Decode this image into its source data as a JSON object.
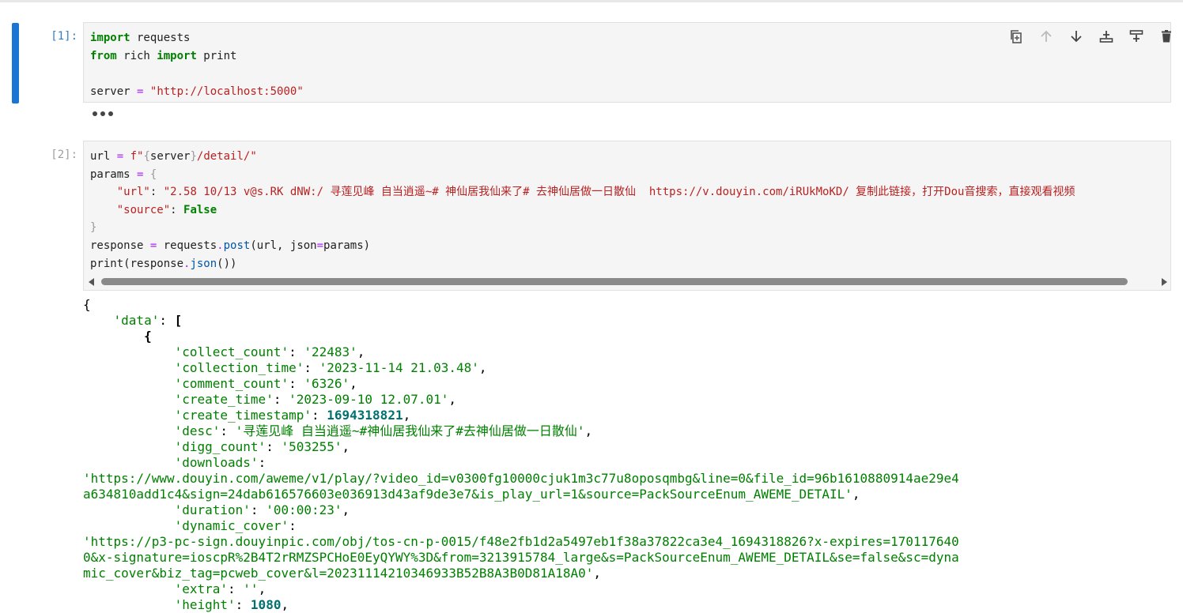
{
  "cells": [
    {
      "prompt": "[1]:",
      "code_lines": [
        [
          {
            "t": "import",
            "c": "kw"
          },
          {
            "t": " requests"
          }
        ],
        [
          {
            "t": "from",
            "c": "kw"
          },
          {
            "t": " rich "
          },
          {
            "t": "import",
            "c": "kw"
          },
          {
            "t": " print"
          }
        ],
        [
          {
            "t": ""
          }
        ],
        [
          {
            "t": "server "
          },
          {
            "t": "=",
            "c": "op"
          },
          {
            "t": " "
          },
          {
            "t": "\"http://localhost:5000\"",
            "c": "str"
          }
        ]
      ]
    },
    {
      "prompt": "[2]:",
      "code_lines": [
        [
          {
            "t": "url "
          },
          {
            "t": "=",
            "c": "op"
          },
          {
            "t": " "
          },
          {
            "t": "f\"",
            "c": "str"
          },
          {
            "t": "{",
            "c": "br"
          },
          {
            "t": "server"
          },
          {
            "t": "}",
            "c": "br"
          },
          {
            "t": "/detail/\"",
            "c": "str"
          }
        ],
        [
          {
            "t": "params "
          },
          {
            "t": "=",
            "c": "op"
          },
          {
            "t": " "
          },
          {
            "t": "{",
            "c": "br"
          }
        ],
        [
          {
            "t": "    "
          },
          {
            "t": "\"url\"",
            "c": "str"
          },
          {
            "t": ": "
          },
          {
            "t": "\"2.58 10/13 v@s.RK dNW:/ 寻莲见峰 自当逍遥~# 神仙居我仙来了# 去神仙居做一日散仙  https://v.douyin.com/iRUkMoKD/ 复制此链接，打开Dou音搜索，直接观看视频",
            "c": "str"
          }
        ],
        [
          {
            "t": "    "
          },
          {
            "t": "\"source\"",
            "c": "str"
          },
          {
            "t": ": "
          },
          {
            "t": "False",
            "c": "kw"
          }
        ],
        [
          {
            "t": "}",
            "c": "br"
          }
        ],
        [
          {
            "t": "response "
          },
          {
            "t": "=",
            "c": "op"
          },
          {
            "t": " requests"
          },
          {
            "t": ".",
            "c": "op"
          },
          {
            "t": "post",
            "c": "fn"
          },
          {
            "t": "(url, json"
          },
          {
            "t": "=",
            "c": "op"
          },
          {
            "t": "params)"
          }
        ],
        [
          {
            "t": "print(response"
          },
          {
            "t": ".",
            "c": "op"
          },
          {
            "t": "json",
            "c": "fn"
          },
          {
            "t": "())"
          }
        ]
      ]
    }
  ],
  "output_lines": [
    [
      {
        "t": "{"
      }
    ],
    [
      {
        "t": "    "
      },
      {
        "t": "'data'",
        "c": "ok"
      },
      {
        "t": ": "
      },
      {
        "t": "[",
        "c": "ob"
      }
    ],
    [
      {
        "t": "        "
      },
      {
        "t": "{",
        "c": "ob"
      }
    ],
    [
      {
        "t": "            "
      },
      {
        "t": "'collect_count'",
        "c": "ok"
      },
      {
        "t": ": "
      },
      {
        "t": "'22483'",
        "c": "ok"
      },
      {
        "t": ","
      }
    ],
    [
      {
        "t": "            "
      },
      {
        "t": "'collection_time'",
        "c": "ok"
      },
      {
        "t": ": "
      },
      {
        "t": "'2023-11-14 21.03.48'",
        "c": "ok"
      },
      {
        "t": ","
      }
    ],
    [
      {
        "t": "            "
      },
      {
        "t": "'comment_count'",
        "c": "ok"
      },
      {
        "t": ": "
      },
      {
        "t": "'6326'",
        "c": "ok"
      },
      {
        "t": ","
      }
    ],
    [
      {
        "t": "            "
      },
      {
        "t": "'create_time'",
        "c": "ok"
      },
      {
        "t": ": "
      },
      {
        "t": "'2023-09-10 12.07.01'",
        "c": "ok"
      },
      {
        "t": ","
      }
    ],
    [
      {
        "t": "            "
      },
      {
        "t": "'create_timestamp'",
        "c": "ok"
      },
      {
        "t": ": "
      },
      {
        "t": "1694318821",
        "c": "on"
      },
      {
        "t": ","
      }
    ],
    [
      {
        "t": "            "
      },
      {
        "t": "'desc'",
        "c": "ok"
      },
      {
        "t": ": "
      },
      {
        "t": "'寻莲见峰 自当逍遥~#神仙居我仙来了#去神仙居做一日散仙'",
        "c": "ok"
      },
      {
        "t": ","
      }
    ],
    [
      {
        "t": "            "
      },
      {
        "t": "'digg_count'",
        "c": "ok"
      },
      {
        "t": ": "
      },
      {
        "t": "'503255'",
        "c": "ok"
      },
      {
        "t": ","
      }
    ],
    [
      {
        "t": "            "
      },
      {
        "t": "'downloads'",
        "c": "ok"
      },
      {
        "t": ":"
      }
    ],
    [
      {
        "t": "'https://www.douyin.com/aweme/v1/play/?video_id=v0300fg10000cjuk1m3c77u8oposqmbg&line=0&file_id=96b1610880914ae29e4",
        "c": "ok"
      }
    ],
    [
      {
        "t": "a634810add1c4&sign=24dab616576603e036913d43af9de3e7&is_play_url=1&source=PackSourceEnum_AWEME_DETAIL'",
        "c": "ok"
      },
      {
        "t": ","
      }
    ],
    [
      {
        "t": "            "
      },
      {
        "t": "'duration'",
        "c": "ok"
      },
      {
        "t": ": "
      },
      {
        "t": "'00:00:23'",
        "c": "ok"
      },
      {
        "t": ","
      }
    ],
    [
      {
        "t": "            "
      },
      {
        "t": "'dynamic_cover'",
        "c": "ok"
      },
      {
        "t": ":"
      }
    ],
    [
      {
        "t": "'https://p3-pc-sign.douyinpic.com/obj/tos-cn-p-0015/f48e2fb1d2a5497eb1f38a37822ca3e4_1694318826?x-expires=170117640",
        "c": "ok"
      }
    ],
    [
      {
        "t": "0&x-signature=ioscpR%2B4T2rRMZSPCHoE0EyQYWY%3D&from=3213915784_large&s=PackSourceEnum_AWEME_DETAIL&se=false&sc=dyna",
        "c": "ok"
      }
    ],
    [
      {
        "t": "mic_cover&biz_tag=pcweb_cover&l=20231114210346933B52B8A3B0D81A18A0'",
        "c": "ok"
      },
      {
        "t": ","
      }
    ],
    [
      {
        "t": "            "
      },
      {
        "t": "'extra'",
        "c": "ok"
      },
      {
        "t": ": "
      },
      {
        "t": "''",
        "c": "ok"
      },
      {
        "t": ","
      }
    ],
    [
      {
        "t": "            "
      },
      {
        "t": "'height'",
        "c": "ok"
      },
      {
        "t": ": "
      },
      {
        "t": "1080",
        "c": "on"
      },
      {
        "t": ","
      }
    ]
  ],
  "toolbar_icons": [
    "duplicate-icon",
    "move-up-icon",
    "move-down-icon",
    "insert-above-icon",
    "insert-below-icon",
    "delete-icon"
  ],
  "colors": {
    "active_bar": "#1976d2",
    "keyword": "#008000",
    "string": "#ba2121",
    "number": "#007070"
  }
}
